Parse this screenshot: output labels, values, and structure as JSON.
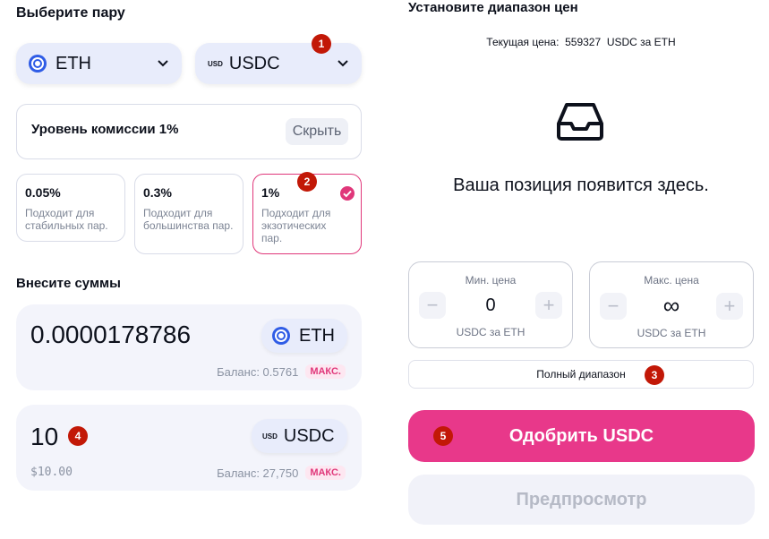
{
  "left": {
    "select_pair_title": "Выберите пару",
    "token_a": {
      "symbol": "ETH"
    },
    "token_b": {
      "symbol": "USDC",
      "logo_text": "USD"
    },
    "fee_tier": {
      "title": "Уровень комиссии 1%",
      "hide_label": "Скрыть"
    },
    "fee_options": [
      {
        "pct": "0.05%",
        "desc": "Подходит для стабильных пар."
      },
      {
        "pct": "0.3%",
        "desc": "Подходит для большинства пар."
      },
      {
        "pct": "1%",
        "desc": "Подходит для экзотических пар.",
        "selected": true
      }
    ],
    "deposit_title": "Внесите суммы",
    "deposit_a": {
      "amount": "0.0000178786",
      "symbol": "ETH",
      "balance": "Баланс: 0.5761",
      "max": "МАКС."
    },
    "deposit_b": {
      "amount": "10",
      "usd_value": "$10.00",
      "symbol": "USDC",
      "logo_text": "USD",
      "balance": "Баланс: 27,750",
      "max": "МАКС."
    }
  },
  "right": {
    "range_title": "Установите диапазон цен",
    "current_price_label": "Текущая цена:",
    "current_price_value": "559327",
    "current_price_unit": "USDC за ETH",
    "empty_message": "Ваша позиция появится здесь.",
    "min_price": {
      "label": "Мин. цена",
      "value": "0",
      "unit": "USDC за ETH"
    },
    "max_price": {
      "label": "Макс. цена",
      "value": "∞",
      "unit": "USDC за ETH"
    },
    "full_range_label": "Полный диапазон",
    "approve_label": "Одобрить USDC",
    "preview_label": "Предпросмотр"
  },
  "badges": [
    "1",
    "2",
    "3",
    "4",
    "5"
  ],
  "colors": {
    "accent": "#e8388a",
    "badge": "#c21807",
    "selected_border": "#e0377a"
  }
}
